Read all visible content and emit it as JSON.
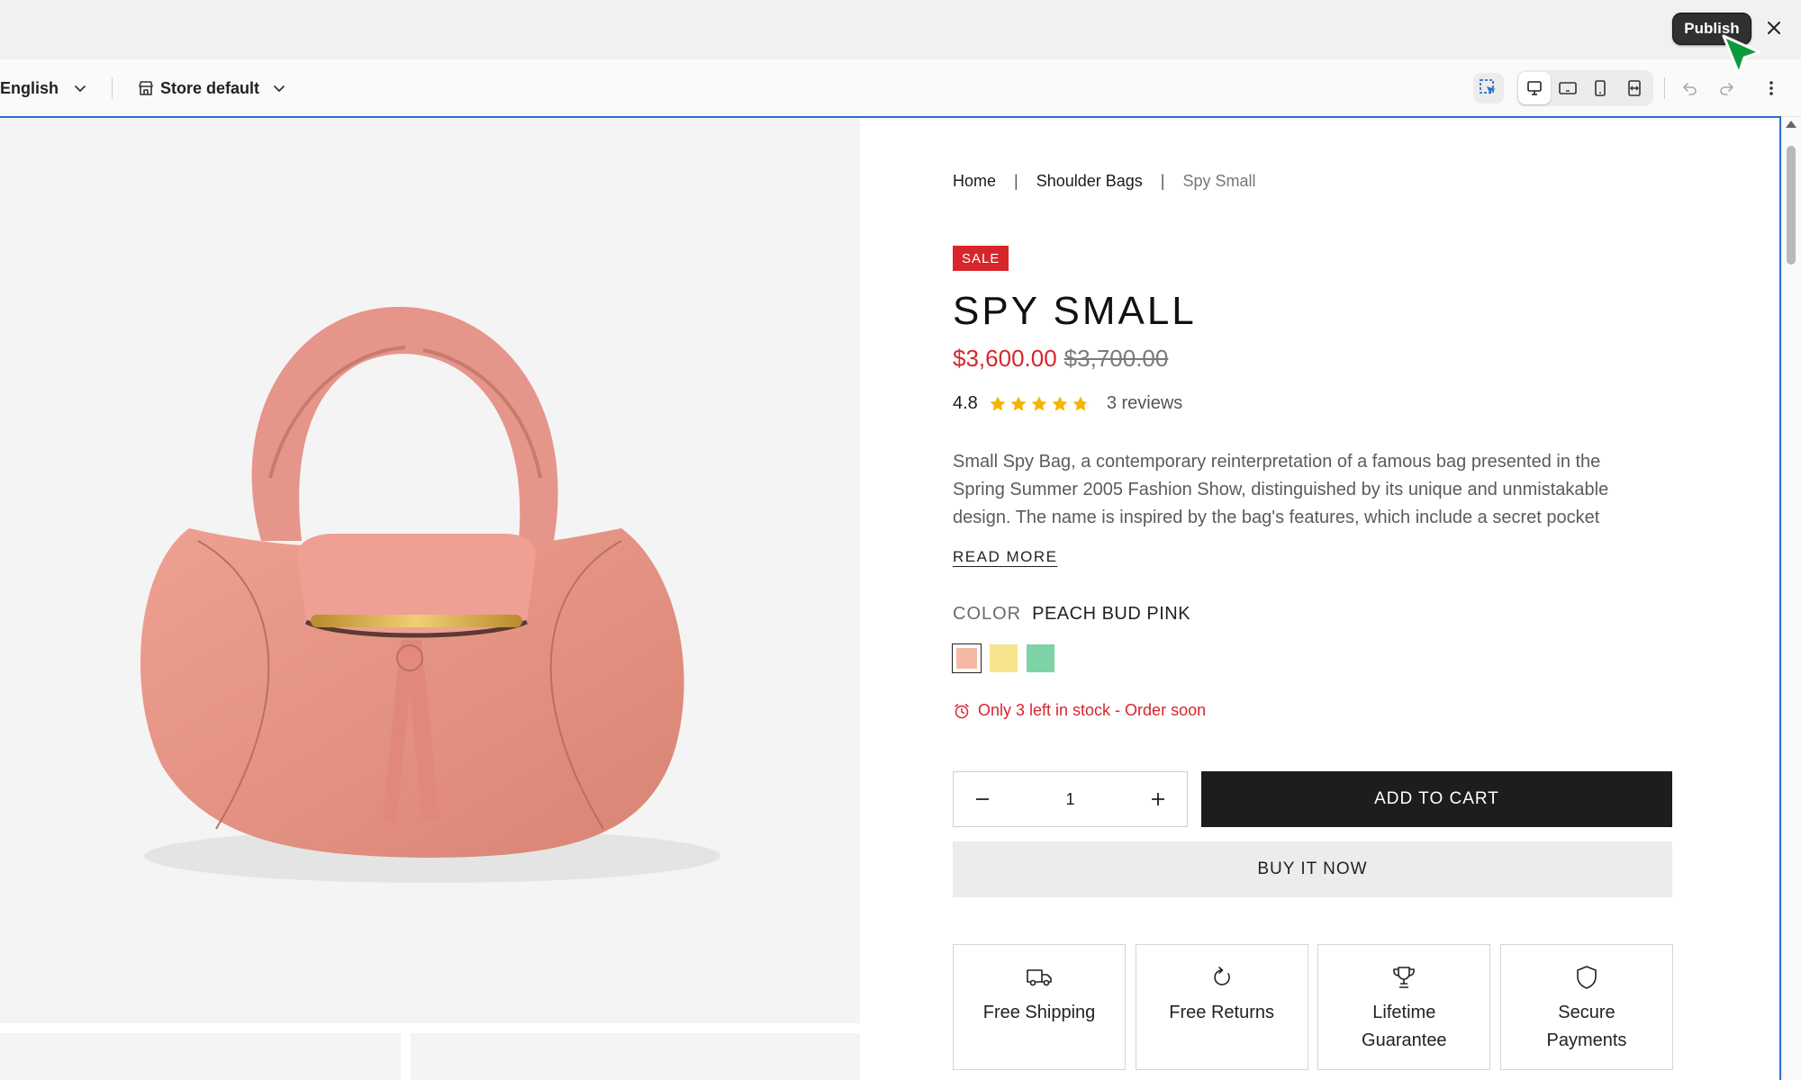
{
  "topbar": {
    "publish_label": "Publish"
  },
  "toolbar": {
    "language": "English",
    "store": "Store default"
  },
  "breadcrumb": {
    "home": "Home",
    "sep": "|",
    "category": "Shoulder Bags",
    "current": "Spy Small"
  },
  "product": {
    "badge": "SALE",
    "title": "SPY SMALL",
    "price_sale": "$3,600.00",
    "price_original": "$3,700.00",
    "rating_value": "4.8",
    "rating_numeric": 4.8,
    "rating_max": 5,
    "reviews": "3 reviews",
    "description_lines": [
      "Small Spy Bag, a contemporary reinterpretation of a famous bag presented in the",
      "Spring Summer 2005 Fashion Show, distinguished by its unique and unmistakable",
      "design. The name is inspired by the bag's features, which include a secret pocket"
    ],
    "read_more": "READ MORE",
    "color_label": "COLOR",
    "color_value": "PEACH BUD PINK",
    "swatches": [
      "#f5b8a5",
      "#f6e48e",
      "#7dd3a6"
    ],
    "stock": "Only 3 left in stock - Order soon",
    "quantity": "1",
    "add_to_cart": "ADD TO CART",
    "buy_now": "BUY IT NOW"
  },
  "features": {
    "shipping": "Free Shipping",
    "returns": "Free Returns",
    "guarantee_line1": "Lifetime",
    "guarantee_line2": "Guarantee",
    "payments_line1": "Secure",
    "payments_line2": "Payments"
  },
  "colors": {
    "accent": "#2c6ecb",
    "sale": "#d7262b",
    "star": "#f4b400",
    "cart_bg": "#1d1d1d"
  }
}
